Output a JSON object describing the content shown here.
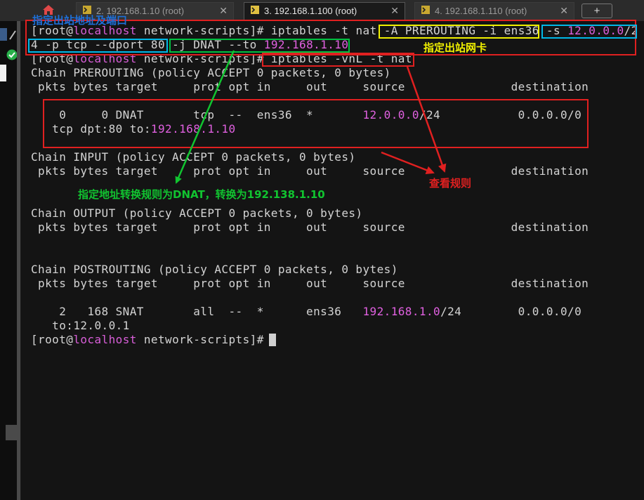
{
  "tabs": [
    {
      "label": "2. 192.168.1.10 (root)",
      "active": false
    },
    {
      "label": "3. 192.168.1.100 (root)",
      "active": true
    },
    {
      "label": "4. 192.168.1.110 (root)",
      "active": false
    }
  ],
  "tab_close_glyph": "✕",
  "new_tab_glyph": "+",
  "terminal": {
    "prompt": {
      "open": "[root@",
      "host": "localhost",
      "rest": " network-scripts]# "
    },
    "cmd1": {
      "a": "iptables -t nat ",
      "b": "-A PREROUTING -i ens36",
      "c": " ",
      "d": "-s ",
      "d_ip": "12.0.0.0",
      "d_tail": "/2",
      "e": "4 -p tcp --dport 80",
      "f": " ",
      "g": "-j DNAT --to ",
      "g_ip": "192.168.1.10"
    },
    "cmd2": "iptables -vnL -t nat",
    "chains": {
      "prerouting": "Chain PREROUTING (policy ACCEPT 0 packets, 0 bytes)",
      "input": "Chain INPUT (policy ACCEPT 0 packets, 0 bytes)",
      "output": "Chain OUTPUT (policy ACCEPT 0 packets, 0 bytes)",
      "postrouting": "Chain POSTROUTING (policy ACCEPT 0 packets, 0 bytes)"
    },
    "header": " pkts bytes target     prot opt in     out     source               destination",
    "dnat_rule": {
      "pre": "    0     0 DNAT       tcp  --  ens36  *       ",
      "src": "12.0.0.0",
      "mid": "/24           0.0.0.0/0",
      "line2_pre": "   tcp dpt:80 to:",
      "line2_ip": "192.168.1.10"
    },
    "snat_rule": {
      "pre": "    2   168 SNAT       all  --  *      ens36   ",
      "src": "192.168.1.0",
      "mid": "/24        0.0.0.0/0",
      "line2": "   to:12.0.0.1"
    }
  },
  "annotations": {
    "source_addr_port": "指定出站地址及端口",
    "out_nic": "指定出站网卡",
    "dnat_note": "指定地址转换规则为DNAT，转换为192.138.1.10",
    "view_rules": "查看规则"
  },
  "colors": {
    "annotation_blue": "#1e6fd8",
    "annotation_yellow": "#f0f000",
    "annotation_green": "#11c430",
    "annotation_red": "#e02020",
    "host_magenta": "#d85ed8"
  },
  "icons": [
    "home-icon",
    "terminal-tab-icon",
    "close-icon",
    "add-tab-icon",
    "check-icon",
    "pin-icon"
  ]
}
